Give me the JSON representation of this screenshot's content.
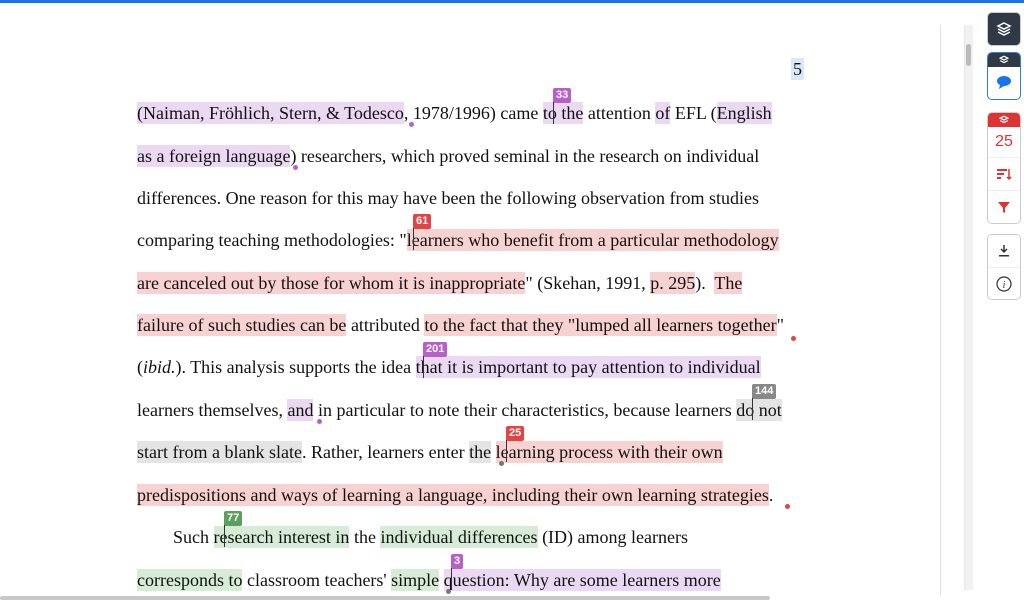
{
  "page_number": "5",
  "lines": [
    [
      {
        "t": "(Naiman, Fröhlich, Stern, & Todesco",
        "h": "p"
      },
      {
        "t": ", 1978/1996) came ",
        "h": ""
      },
      {
        "t": "to the",
        "h": "p"
      },
      {
        "t": " attention ",
        "h": ""
      },
      {
        "t": "of",
        "h": "p"
      },
      {
        "t": " EFL (",
        "h": ""
      },
      {
        "t": "English",
        "h": "p"
      }
    ],
    [
      {
        "t": "as a foreign language",
        "h": "p"
      },
      {
        "t": ") researchers, which proved seminal in the research on individual",
        "h": ""
      }
    ],
    [
      {
        "t": "differences. One reason for this may have been the following observation from studies",
        "h": ""
      }
    ],
    [
      {
        "t": "comparing teaching methodologies: \"",
        "h": ""
      },
      {
        "t": "learners who benefit from a particular methodology",
        "h": "r"
      }
    ],
    [
      {
        "t": "are canceled out by those for whom it is inappropriate",
        "h": "r"
      },
      {
        "t": "\" (Skehan, 1991, ",
        "h": ""
      },
      {
        "t": "p. 295",
        "h": "r"
      },
      {
        "t": ").  ",
        "h": ""
      },
      {
        "t": "The",
        "h": "r"
      }
    ],
    [
      {
        "t": "failure of such studies can be",
        "h": "r"
      },
      {
        "t": " attributed ",
        "h": ""
      },
      {
        "t": "to the fact that they \"lumped all learners together",
        "h": "r"
      },
      {
        "t": "\"",
        "h": ""
      }
    ],
    [
      {
        "t": "(",
        "h": ""
      },
      {
        "t": "ibid.",
        "h": "i"
      },
      {
        "t": "). This analysis supports the idea ",
        "h": ""
      },
      {
        "t": "that it is important to pay attention to individual",
        "h": "p"
      }
    ],
    [
      {
        "t": "learners themselves, ",
        "h": ""
      },
      {
        "t": "and",
        "h": "p"
      },
      {
        "t": " in particular to note their characteristics, because learners ",
        "h": ""
      },
      {
        "t": "do not",
        "h": "gr"
      }
    ],
    [
      {
        "t": "start from a blank slate",
        "h": "gr"
      },
      {
        "t": ". Rather, learners enter ",
        "h": ""
      },
      {
        "t": "the",
        "h": "gr"
      },
      {
        "t": " ",
        "h": ""
      },
      {
        "t": "learning process with their own",
        "h": "r"
      }
    ],
    [
      {
        "t": "predispositions and ways of learning a language, including their own learning strategies",
        "h": "r"
      },
      {
        "t": ".",
        "h": ""
      }
    ],
    [
      {
        "t": "        Such ",
        "h": ""
      },
      {
        "t": "research interest in",
        "h": "g"
      },
      {
        "t": " the ",
        "h": ""
      },
      {
        "t": "individual differences",
        "h": "g"
      },
      {
        "t": " (ID) among learners",
        "h": ""
      }
    ],
    [
      {
        "t": "corresponds to",
        "h": "g"
      },
      {
        "t": " classroom teachers' ",
        "h": ""
      },
      {
        "t": "simple",
        "h": "g"
      },
      {
        "t": " ",
        "h": ""
      },
      {
        "t": "question: Why are some learners more",
        "h": "p"
      }
    ]
  ],
  "badges": [
    {
      "label": "33",
      "color": "p"
    },
    {
      "label": "61",
      "color": "r"
    },
    {
      "label": "201",
      "color": "p"
    },
    {
      "label": "144",
      "color": "gr"
    },
    {
      "label": "25",
      "color": "r"
    },
    {
      "label": "77",
      "color": "g"
    },
    {
      "label": "3",
      "color": "p"
    }
  ],
  "toolbar": {
    "layers_icon": "layers-icon",
    "comment_icon": "comment-icon",
    "count": "25",
    "sort_icon": "sort-icon",
    "filter_icon": "filter-icon",
    "download_icon": "download-icon",
    "info_icon": "info-icon"
  },
  "colors": {
    "purple": "#ebd8f2",
    "red": "#f8d2d0",
    "green": "#d6ecd6",
    "gray": "#e4e4e4",
    "accent": "#1a73e8"
  }
}
